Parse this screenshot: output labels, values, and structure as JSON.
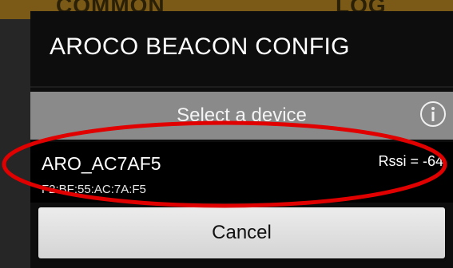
{
  "background": {
    "tabs": [
      "COMMON",
      "LOG"
    ],
    "accent": "#7a5a16"
  },
  "dialog": {
    "title": "AROCO BEACON CONFIG",
    "select_label": "Select a device",
    "info_icon": "info-circle-icon",
    "devices": [
      {
        "name": "ARO_AC7AF5",
        "mac": "F2:BF:55:AC:7A:F5",
        "rssi": "Rssi = -64"
      }
    ],
    "cancel_label": "Cancel"
  },
  "colors": {
    "highlight": "#e00000",
    "header_bg": "#8a8a8a",
    "dialog_bg": "#0d0d0d"
  }
}
